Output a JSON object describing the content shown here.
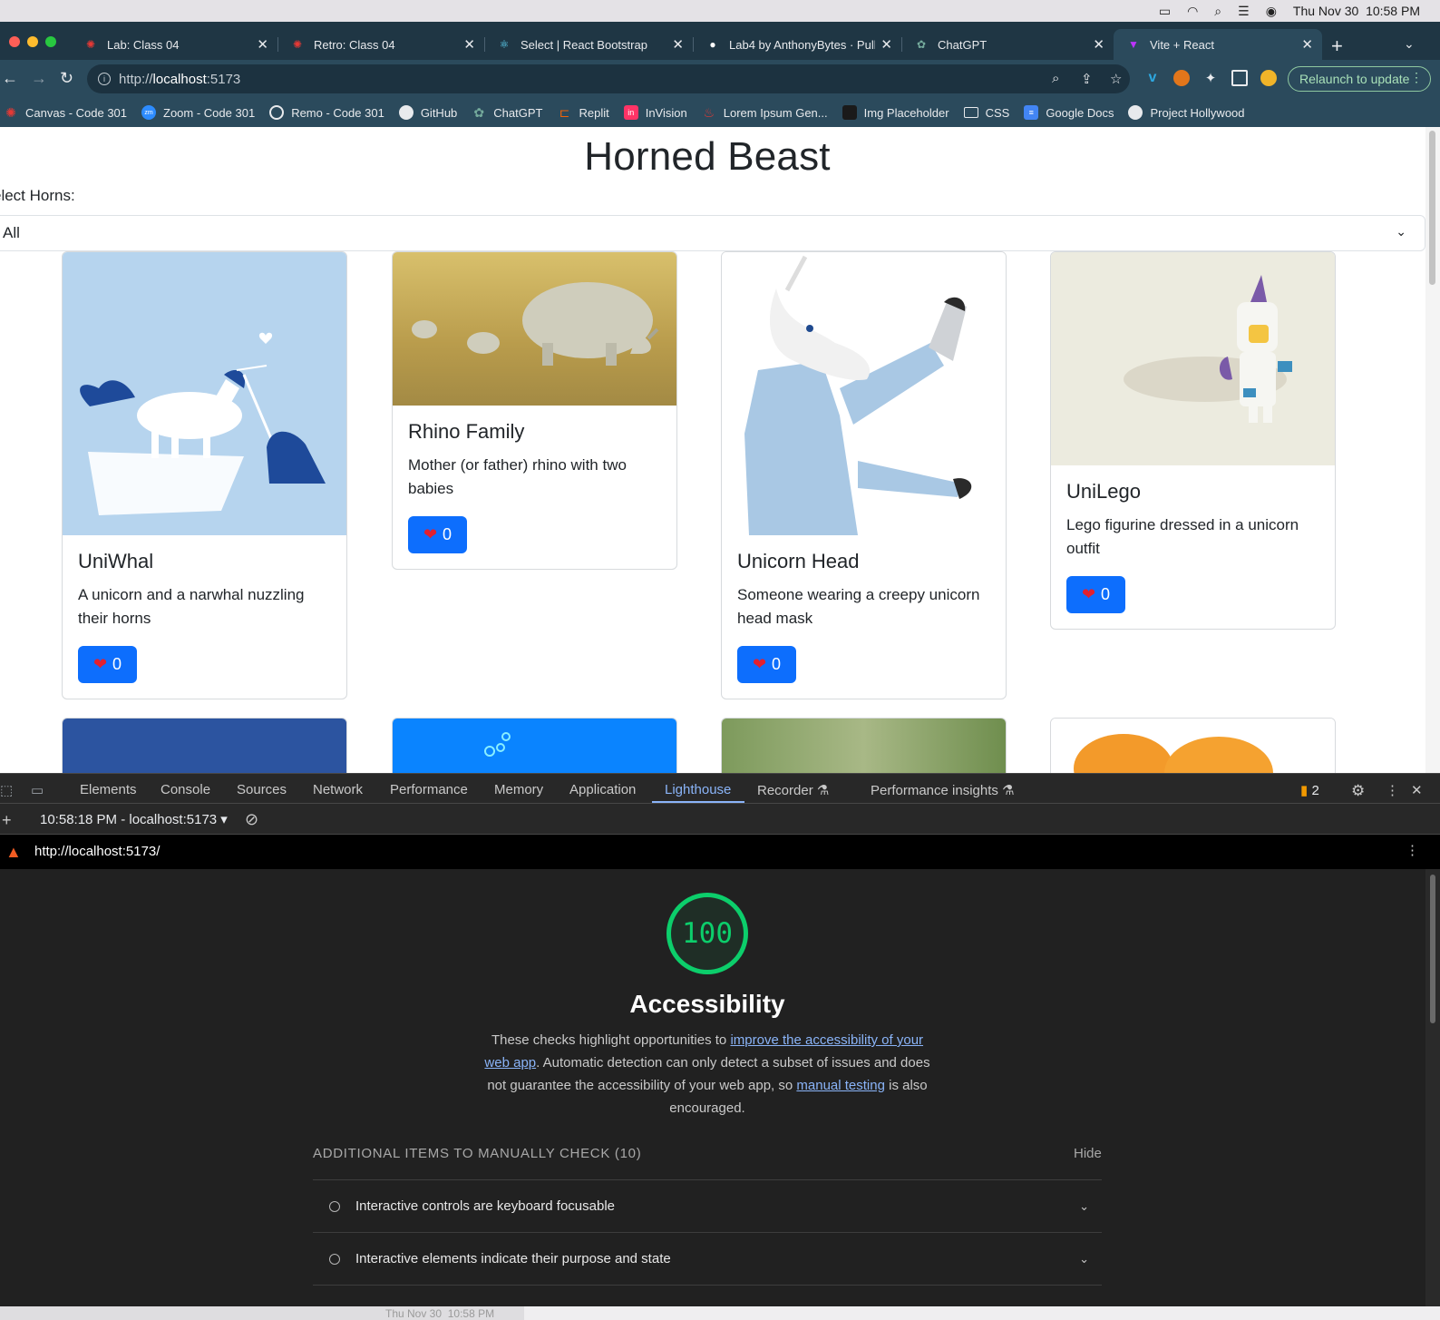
{
  "menubar": {
    "date": "Thu Nov 30",
    "time": "10:58 PM"
  },
  "browser": {
    "tabs": [
      {
        "label": "Lab: Class 04",
        "icon": "canvas-icon"
      },
      {
        "label": "Retro: Class 04",
        "icon": "canvas-icon"
      },
      {
        "label": "Select | React Bootstrap",
        "icon": "react-icon"
      },
      {
        "label": "Lab4 by AnthonyBytes · Pull",
        "icon": "github-icon"
      },
      {
        "label": "ChatGPT",
        "icon": "chatgpt-icon"
      },
      {
        "label": "Vite + React",
        "icon": "vite-icon"
      }
    ],
    "url_prefix": "http://",
    "url_host": "localhost",
    "url_port": ":5173",
    "relaunch": "Relaunch to update",
    "bookmarks": [
      {
        "label": "Canvas - Code 301",
        "icon": "canvas-icon"
      },
      {
        "label": "Zoom - Code 301",
        "icon": "zoom-icon"
      },
      {
        "label": "Remo - Code 301",
        "icon": "remo-icon"
      },
      {
        "label": "GitHub",
        "icon": "github-icon"
      },
      {
        "label": "ChatGPT",
        "icon": "chatgpt-icon"
      },
      {
        "label": "Replit",
        "icon": "replit-icon"
      },
      {
        "label": "InVision",
        "icon": "invision-icon"
      },
      {
        "label": "Lorem Ipsum Gen...",
        "icon": "lorem-icon"
      },
      {
        "label": "Img Placeholder",
        "icon": "image-icon"
      },
      {
        "label": "CSS",
        "icon": "folder-icon"
      },
      {
        "label": "Google Docs",
        "icon": "docs-icon"
      },
      {
        "label": "Project Hollywood",
        "icon": "github-icon"
      }
    ]
  },
  "page": {
    "title": "Horned Beast",
    "select_label": "elect Horns:",
    "select_value": "All",
    "cards": [
      {
        "title": "UniWhal",
        "text": "A unicorn and a narwhal nuzzling their horns",
        "likes": "0"
      },
      {
        "title": "Rhino Family",
        "text": "Mother (or father) rhino with two babies",
        "likes": "0"
      },
      {
        "title": "Unicorn Head",
        "text": "Someone wearing a creepy unicorn head mask",
        "likes": "0"
      },
      {
        "title": "UniLego",
        "text": "Lego figurine dressed in a unicorn outfit",
        "likes": "0"
      }
    ]
  },
  "devtools": {
    "tabs": [
      "Elements",
      "Console",
      "Sources",
      "Network",
      "Performance",
      "Memory",
      "Application",
      "Lighthouse",
      "Recorder",
      "Performance insights"
    ],
    "active_tab": "Lighthouse",
    "issues_count": "2",
    "report_selector": "10:58:18 PM - localhost:5173",
    "report_url": "http://localhost:5173/",
    "score": "100",
    "category": "Accessibility",
    "desc_1": "These checks highlight opportunities to ",
    "desc_link_1": "improve the accessibility of your web app",
    "desc_2": ". Automatic detection can only detect a subset of issues and does not guarantee the accessibility of your web app, so ",
    "desc_link_2": "manual testing",
    "desc_3": " is also encouraged.",
    "manual_heading": "ADDITIONAL ITEMS TO MANUALLY CHECK",
    "manual_count": "(10)",
    "hide": "Hide",
    "audits": [
      "Interactive controls are keyboard focusable",
      "Interactive elements indicate their purpose and state"
    ]
  },
  "colors": {
    "accent": "#0d6efd",
    "score_green": "#0cce6b",
    "chrome_frame": "#1f3644",
    "chrome_toolbar": "#2b4a5c"
  }
}
